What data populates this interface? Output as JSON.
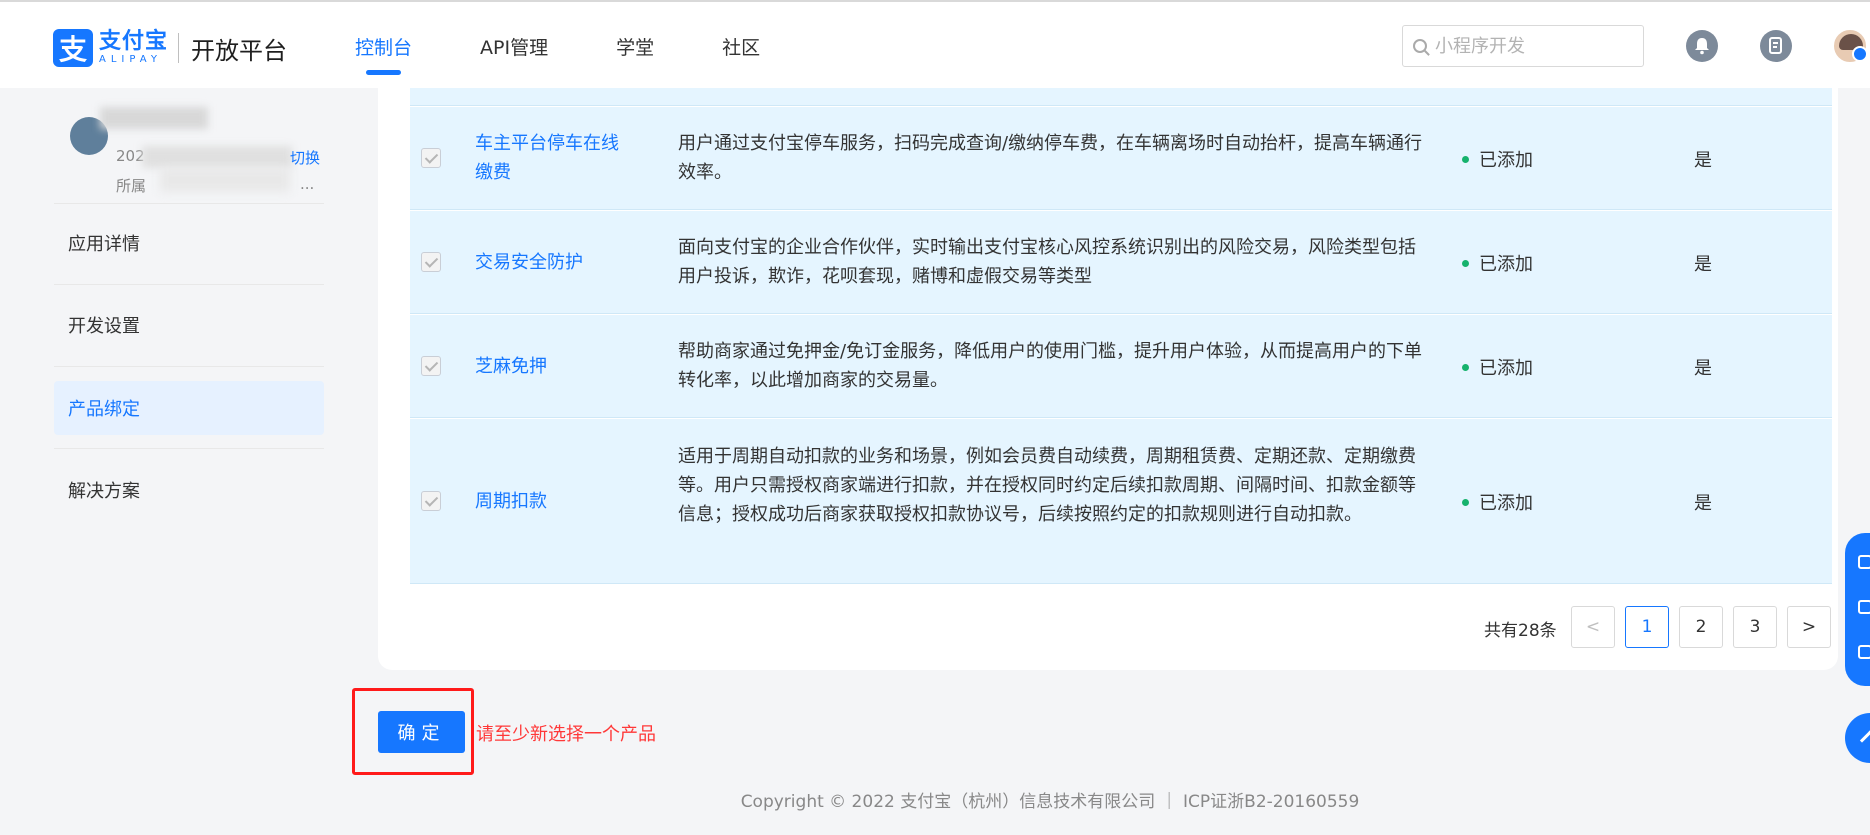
{
  "header": {
    "logo_cn": "支付宝",
    "logo_en": "ALIPAY",
    "platform_title": "开放平台",
    "nav": [
      {
        "label": "控制台",
        "active": true
      },
      {
        "label": "API管理",
        "active": false
      },
      {
        "label": "学堂",
        "active": false
      },
      {
        "label": "社区",
        "active": false
      }
    ],
    "search_placeholder": "小程序开发"
  },
  "sidebar": {
    "account": {
      "line1": "202",
      "line2": "所属",
      "switch_label": "切换",
      "ellipsis": "..."
    },
    "items": [
      {
        "label": "应用详情",
        "active": false
      },
      {
        "label": "开发设置",
        "active": false
      },
      {
        "label": "产品绑定",
        "active": true
      },
      {
        "label": "解决方案",
        "active": false
      }
    ]
  },
  "products": [
    {
      "name": "车主平台停车在线缴费",
      "description": "用户通过支付宝停车服务，扫码完成查询/缴纳停车费，在车辆离场时自动抬杆，提高车辆通行效率。",
      "status": "已添加",
      "required": "是"
    },
    {
      "name": "交易安全防护",
      "description": "面向支付宝的企业合作伙伴，实时输出支付宝核心风控系统识别出的风险交易，风险类型包括用户投诉，欺诈，花呗套现，赌博和虚假交易等类型",
      "status": "已添加",
      "required": "是"
    },
    {
      "name": "芝麻免押",
      "description": "帮助商家通过免押金/免订金服务，降低用户的使用门槛，提升用户体验，从而提高用户的下单转化率，以此增加商家的交易量。",
      "status": "已添加",
      "required": "是"
    },
    {
      "name": "周期扣款",
      "description": "适用于周期自动扣款的业务和场景，例如会员费自动续费，周期租赁费、定期还款、定期缴费等。用户只需授权商家端进行扣款，并在授权同时约定后续扣款周期、间隔时间、扣款金额等信息；授权成功后商家获取授权扣款协议号，后续按照约定的扣款规则进行自动扣款。",
      "status": "已添加",
      "required": "是"
    }
  ],
  "pagination": {
    "total": "共有28条",
    "prev": "<",
    "next": ">",
    "pages": [
      "1",
      "2",
      "3"
    ],
    "current": "1"
  },
  "actions": {
    "confirm_label": "确定",
    "error_message": "请至少新选择一个产品"
  },
  "footer": {
    "copyright": "Copyright © 2022 支付宝（杭州）信息技术有限公司 ｜ ICP证浙B2-20160559"
  },
  "colors": {
    "accent": "#1677ff",
    "row_highlight": "#e5f5ff",
    "status_dot": "#15b26d",
    "error": "#ff3838"
  }
}
